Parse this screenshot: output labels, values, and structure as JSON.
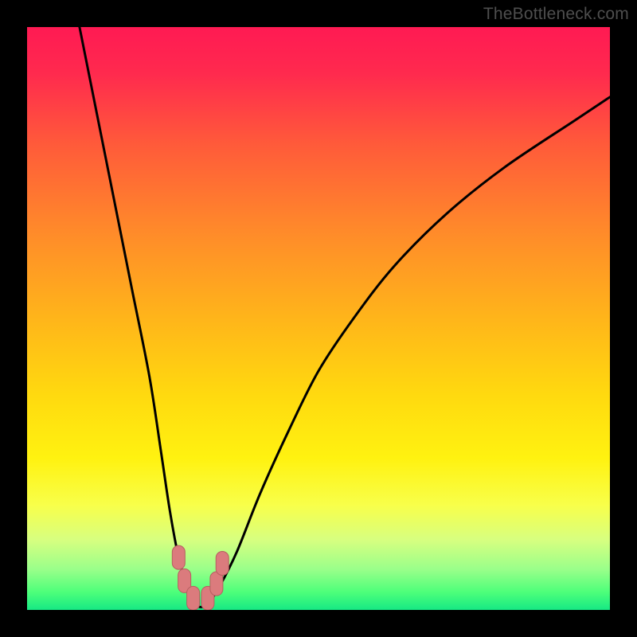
{
  "attribution": "TheBottleneck.com",
  "colors": {
    "frame": "#000000",
    "gradient_stops": [
      {
        "offset": 0.0,
        "color": "#ff1a53"
      },
      {
        "offset": 0.08,
        "color": "#ff2a4e"
      },
      {
        "offset": 0.2,
        "color": "#ff5a3a"
      },
      {
        "offset": 0.35,
        "color": "#ff8a2a"
      },
      {
        "offset": 0.5,
        "color": "#ffb51a"
      },
      {
        "offset": 0.63,
        "color": "#ffd90f"
      },
      {
        "offset": 0.74,
        "color": "#fff210"
      },
      {
        "offset": 0.82,
        "color": "#f8ff4a"
      },
      {
        "offset": 0.88,
        "color": "#d7ff80"
      },
      {
        "offset": 0.93,
        "color": "#9aff8a"
      },
      {
        "offset": 0.97,
        "color": "#4cff7a"
      },
      {
        "offset": 1.0,
        "color": "#16e884"
      }
    ],
    "curve": "#000000",
    "marker_fill": "#db7b7d",
    "marker_stroke": "#b65e60"
  },
  "chart_data": {
    "type": "line",
    "title": "",
    "xlabel": "",
    "ylabel": "",
    "xlim": [
      0,
      100
    ],
    "ylim": [
      0,
      100
    ],
    "grid": false,
    "series": [
      {
        "name": "bottleneck-curve",
        "x": [
          9,
          12,
          15,
          18,
          21,
          23,
          24.5,
          26,
          27.5,
          29,
          30,
          31,
          33,
          36,
          40,
          45,
          50,
          56,
          63,
          72,
          82,
          94,
          100
        ],
        "values": [
          100,
          85,
          70,
          55,
          40,
          27,
          17,
          9,
          4,
          1,
          0.5,
          1,
          4,
          10,
          20,
          31,
          41,
          50,
          59,
          68,
          76,
          84,
          88
        ]
      }
    ],
    "markers": [
      {
        "x": 26.0,
        "y": 9.0
      },
      {
        "x": 27.0,
        "y": 5.0
      },
      {
        "x": 28.5,
        "y": 2.0
      },
      {
        "x": 31.0,
        "y": 2.0
      },
      {
        "x": 32.5,
        "y": 4.5
      },
      {
        "x": 33.5,
        "y": 8.0
      }
    ]
  }
}
